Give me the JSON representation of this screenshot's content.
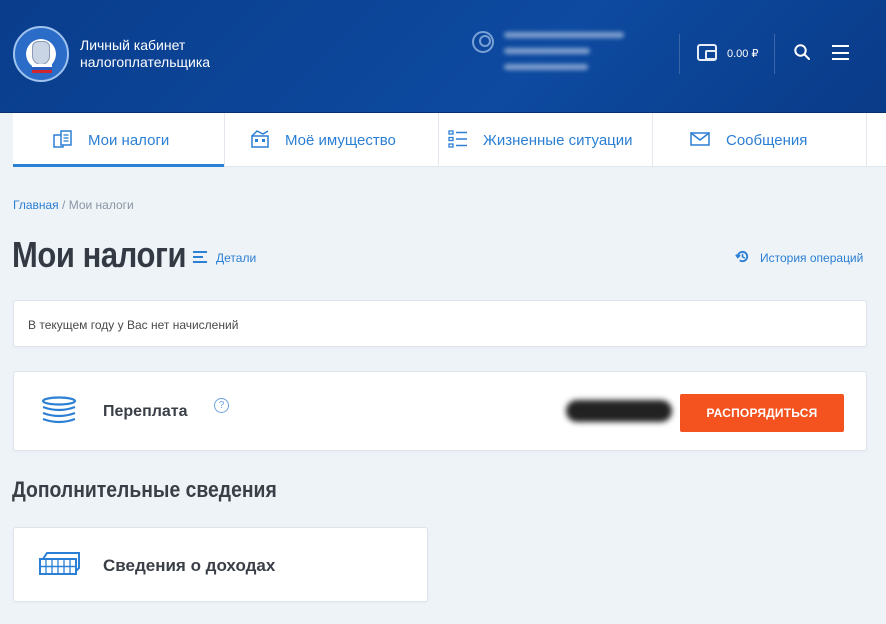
{
  "header": {
    "app_title_line1": "Личный кабинет",
    "app_title_line2": "налогоплательщика",
    "balance": "0.00 ₽",
    "icons": [
      "logo",
      "user-icon",
      "wallet-icon",
      "search-icon",
      "menu-icon"
    ]
  },
  "nav": {
    "items": [
      {
        "label": "Мои налоги",
        "icon": "tax-docs-icon",
        "active": true
      },
      {
        "label": "Моё имущество",
        "icon": "property-icon",
        "active": false
      },
      {
        "label": "Жизненные ситуации",
        "icon": "list-icon",
        "active": false
      },
      {
        "label": "Сообщения",
        "icon": "envelope-icon",
        "active": false
      }
    ]
  },
  "breadcrumb": {
    "home": "Главная",
    "separator": " / ",
    "current": "Мои налоги"
  },
  "page": {
    "title": "Мои налоги",
    "details_link": "Детали",
    "history_link": "История операций"
  },
  "notice": {
    "text": "В текущем году у Вас нет начислений"
  },
  "overpayment": {
    "title": "Переплата",
    "help": "?",
    "button_label": "РАСПОРЯДИТЬСЯ"
  },
  "additional": {
    "section_title": "Дополнительные сведения",
    "income_card_title": "Сведения о доходах"
  },
  "colors": {
    "header_bg": "#0d4aa0",
    "accent": "#2b7fd4",
    "button": "#f4521f",
    "page_bg": "#eef3f7"
  }
}
